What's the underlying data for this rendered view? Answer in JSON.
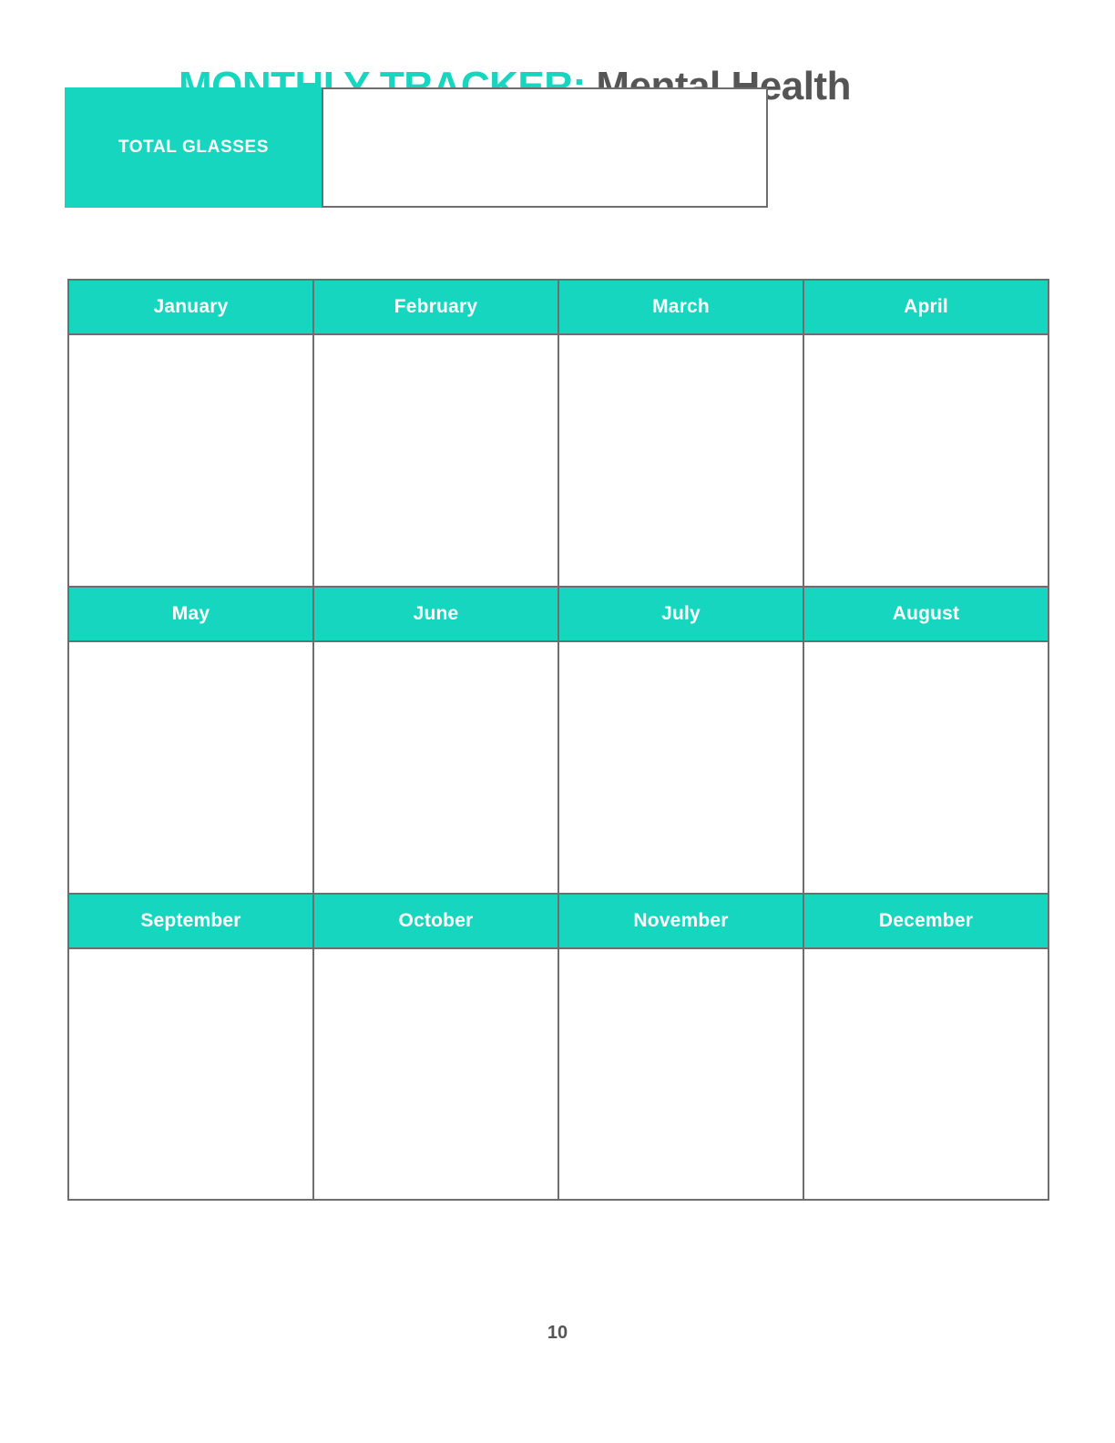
{
  "header": {
    "title_accent": "MONTHLY TRACKER:",
    "title_main": " Mental Health"
  },
  "summary": {
    "label": "TOTAL GLASSES",
    "value": ""
  },
  "tracker": {
    "rows": [
      {
        "months": [
          "January",
          "February",
          "March",
          "April"
        ]
      },
      {
        "months": [
          "May",
          "June",
          "July",
          "August"
        ]
      },
      {
        "months": [
          "September",
          "October",
          "November",
          "December"
        ]
      }
    ]
  },
  "footer": {
    "page_number": "10"
  },
  "colors": {
    "accent": "#17D6C0",
    "text_dark": "#555555",
    "border": "#6E6E6E",
    "on_accent": "#FFFFFF"
  }
}
